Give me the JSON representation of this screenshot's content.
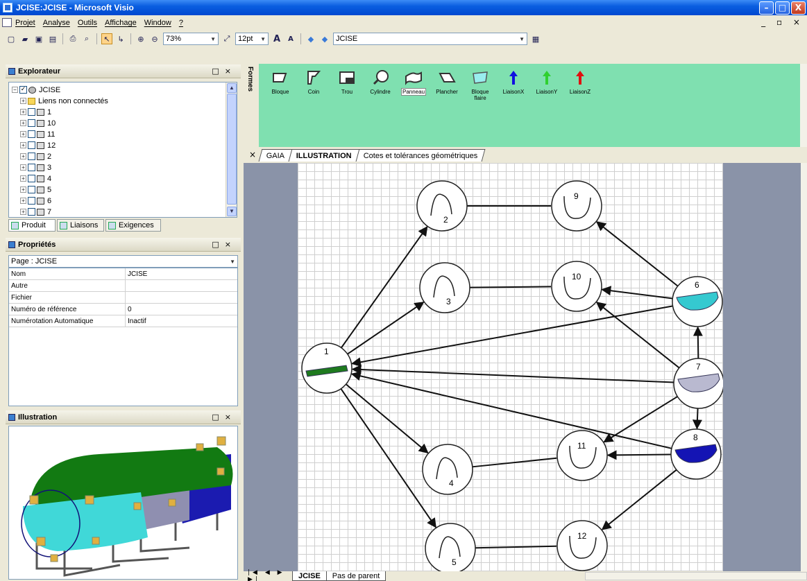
{
  "window": {
    "title": "JCISE:JCISE - Microsoft Visio",
    "buttons": {
      "minimize": "–",
      "maximize": "□",
      "close": "X"
    }
  },
  "menu": {
    "items": [
      "Projet",
      "Analyse",
      "Outils",
      "Affichage",
      "Window",
      "?"
    ]
  },
  "toolbar": {
    "zoom": "73%",
    "font_size": "12pt",
    "page_combo": "JCISE",
    "font_grow": "A",
    "font_shrink": "A"
  },
  "explorer": {
    "title": "Explorateur",
    "root": "JCISE",
    "items": [
      "Liens non connectés",
      "1",
      "10",
      "11",
      "12",
      "2",
      "3",
      "4",
      "5",
      "6",
      "7"
    ],
    "tabs": [
      "Produit",
      "Liaisons",
      "Exigences"
    ]
  },
  "properties": {
    "title": "Propriétés",
    "selector": "Page : JCISE",
    "rows": [
      {
        "key": "Nom",
        "value": "JCISE"
      },
      {
        "key": "Autre",
        "value": ""
      },
      {
        "key": "Fichier",
        "value": ""
      },
      {
        "key": "Numéro de référence",
        "value": "0"
      },
      {
        "key": "Numérotation Automatique",
        "value": "Inactif"
      }
    ]
  },
  "illustration": {
    "title": "Illustration"
  },
  "stencil": {
    "title": "Formes",
    "shapes": [
      "Bloque",
      "Coin",
      "Trou",
      "Cylindre",
      "Panneau",
      "Plancher",
      "Bloque\nflaire",
      "LiaisonX",
      "LiaisonY",
      "LiaisonZ"
    ],
    "selected": "Panneau",
    "tabs": [
      "GAIA",
      "ILLUSTRATION",
      "Cotes et tolérances géométriques"
    ],
    "active_tab": "ILLUSTRATION"
  },
  "diagram": {
    "nodes": [
      "1",
      "2",
      "3",
      "4",
      "5",
      "6",
      "7",
      "8",
      "9",
      "10",
      "11",
      "12"
    ]
  },
  "page_tabs": [
    "JCISE",
    "Pas de parent"
  ],
  "colors": {
    "titlebar": "#0a5ee0",
    "stencil_bg": "#7fe0b0",
    "node1_part": "#1e7a1e",
    "node6_part": "#35c9d0",
    "node7_part": "#b9b9d0",
    "node8_part": "#1414b4",
    "liaison_x": "#1010e0",
    "liaison_y": "#30d030",
    "liaison_z": "#e01010"
  }
}
